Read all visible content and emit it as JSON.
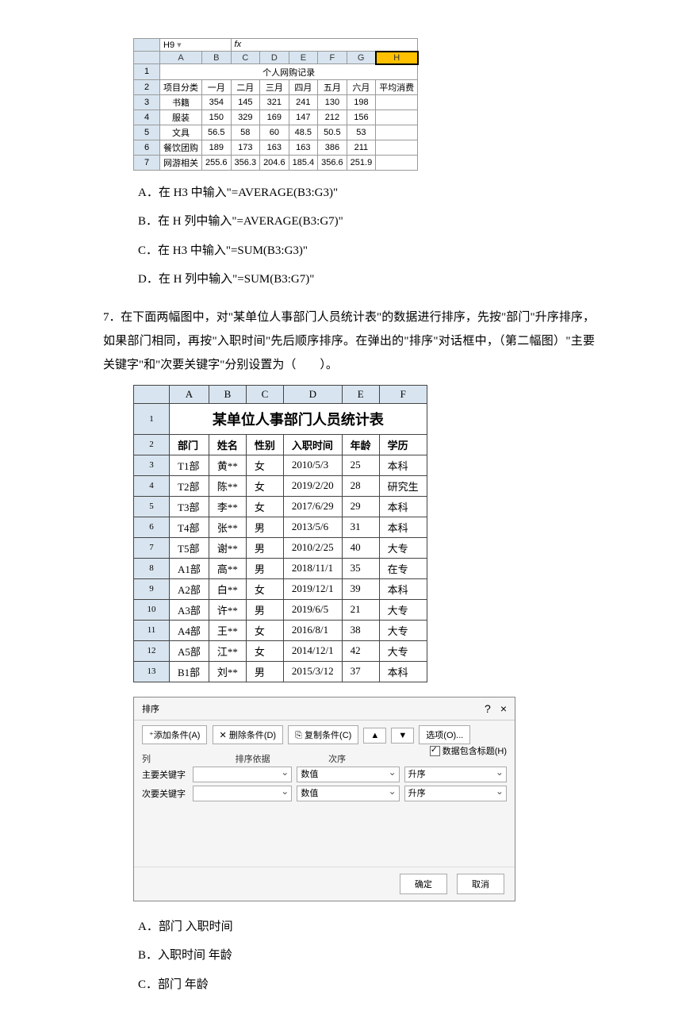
{
  "excel1": {
    "namebox": "H9",
    "fxlabel": "fx",
    "cols": [
      "A",
      "B",
      "C",
      "D",
      "E",
      "F",
      "G",
      "H"
    ],
    "title": "个人网购记录",
    "headers": [
      "项目分类",
      "一月",
      "二月",
      "三月",
      "四月",
      "五月",
      "六月",
      "平均消费"
    ],
    "rows": [
      [
        "书籍",
        "354",
        "145",
        "321",
        "241",
        "130",
        "198",
        ""
      ],
      [
        "服装",
        "150",
        "329",
        "169",
        "147",
        "212",
        "156",
        ""
      ],
      [
        "文具",
        "56.5",
        "58",
        "60",
        "48.5",
        "50.5",
        "53",
        ""
      ],
      [
        "餐饮团购",
        "189",
        "173",
        "163",
        "163",
        "386",
        "211",
        ""
      ],
      [
        "网游相关",
        "255.6",
        "356.3",
        "204.6",
        "185.4",
        "356.6",
        "251.9",
        ""
      ]
    ]
  },
  "optsA": {
    "a": "A．在 H3 中输入\"=AVERAGE(B3:G3)\"",
    "b": "B．在 H 列中输入\"=AVERAGE(B3:G7)\"",
    "c": "C．在 H3 中输入\"=SUM(B3:G3)\"",
    "d": "D．在 H 列中输入\"=SUM(B3:G7)\""
  },
  "q7": {
    "num": "7．",
    "text": "在下面两幅图中，对\"某单位人事部门人员统计表\"的数据进行排序，先按\"部门\"升序排序，如果部门相同，再按\"入职时间\"先后顺序排序。在弹出的\"排序\"对话框中，（第二幅图）\"主要关键字\"和\"次要关键字\"分别设置为（　　）。"
  },
  "tbl2": {
    "cols": [
      "A",
      "B",
      "C",
      "D",
      "E",
      "F"
    ],
    "title": "某单位人事部门人员统计表",
    "headers": [
      "部门",
      "姓名",
      "性别",
      "入职时间",
      "年龄",
      "学历"
    ],
    "rows": [
      [
        "T1部",
        "黄**",
        "女",
        "2010/5/3",
        "25",
        "本科"
      ],
      [
        "T2部",
        "陈**",
        "女",
        "2019/2/20",
        "28",
        "研究生"
      ],
      [
        "T3部",
        "李**",
        "女",
        "2017/6/29",
        "29",
        "本科"
      ],
      [
        "T4部",
        "张**",
        "男",
        "2013/5/6",
        "31",
        "本科"
      ],
      [
        "T5部",
        "谢**",
        "男",
        "2010/2/25",
        "40",
        "大专"
      ],
      [
        "A1部",
        "高**",
        "男",
        "2018/11/1",
        "35",
        "在专"
      ],
      [
        "A2部",
        "白**",
        "女",
        "2019/12/1",
        "39",
        "本科"
      ],
      [
        "A3部",
        "许**",
        "男",
        "2019/6/5",
        "21",
        "大专"
      ],
      [
        "A4部",
        "王**",
        "女",
        "2016/8/1",
        "38",
        "大专"
      ],
      [
        "A5部",
        "江**",
        "女",
        "2014/12/1",
        "42",
        "大专"
      ],
      [
        "B1部",
        "刘**",
        "男",
        "2015/3/12",
        "37",
        "本科"
      ]
    ]
  },
  "dialog": {
    "title": "排序",
    "help": "?",
    "close": "×",
    "addBtn": "添加条件(A)",
    "delBtn": "删除条件(D)",
    "copyBtn": "复制条件(C)",
    "optBtn": "选项(O)...",
    "chk": "数据包含标题(H)",
    "colHdr": "列",
    "basisHdr": "排序依据",
    "orderHdr": "次序",
    "key1": "主要关键字",
    "key2": "次要关键字",
    "basis": "数值",
    "order": "升序",
    "ok": "确定",
    "cancel": "取消"
  },
  "optsB": {
    "a": "A．部门   入职时间",
    "b": "B．入职时间   年龄",
    "c": "C．部门   年龄"
  }
}
